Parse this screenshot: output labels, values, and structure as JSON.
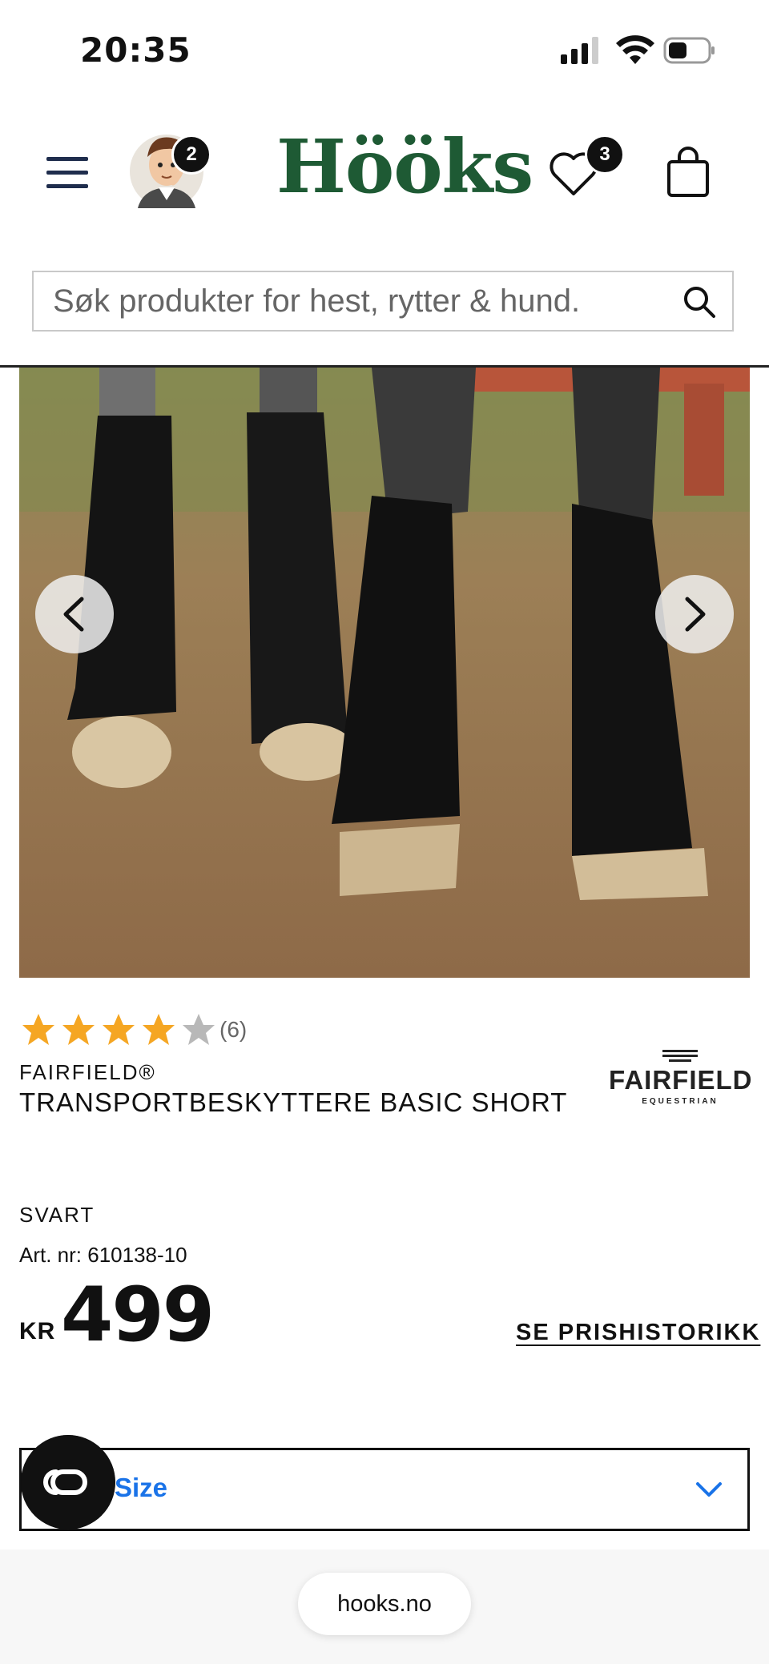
{
  "status_bar": {
    "time": "20:35"
  },
  "header": {
    "logo": "Hööks",
    "avatar_badge": "2",
    "wishlist_badge": "3"
  },
  "search": {
    "placeholder": "Søk produkter for hest, rytter & hund."
  },
  "product": {
    "rating": {
      "value": 4,
      "max": 5,
      "count_label": "(6)"
    },
    "brand": "FAIRFIELD®",
    "name": "TRANSPORTBESKYTTERE BASIC SHORT",
    "brand_logo": {
      "name": "FAIRFIELD",
      "sub": "EQUESTRIAN"
    },
    "color": "SVART",
    "article_number": "Art. nr: 610138-10",
    "currency": "KR",
    "price": "499",
    "price_history_link": "SE PRISHISTORIKK",
    "size_select": {
      "label": "Size"
    }
  },
  "browser": {
    "url": "hooks.no"
  },
  "colors": {
    "brand_green": "#1e5a34",
    "star": "#f5a623",
    "star_empty": "#b8b8b8",
    "link_blue": "#1a73e8"
  }
}
